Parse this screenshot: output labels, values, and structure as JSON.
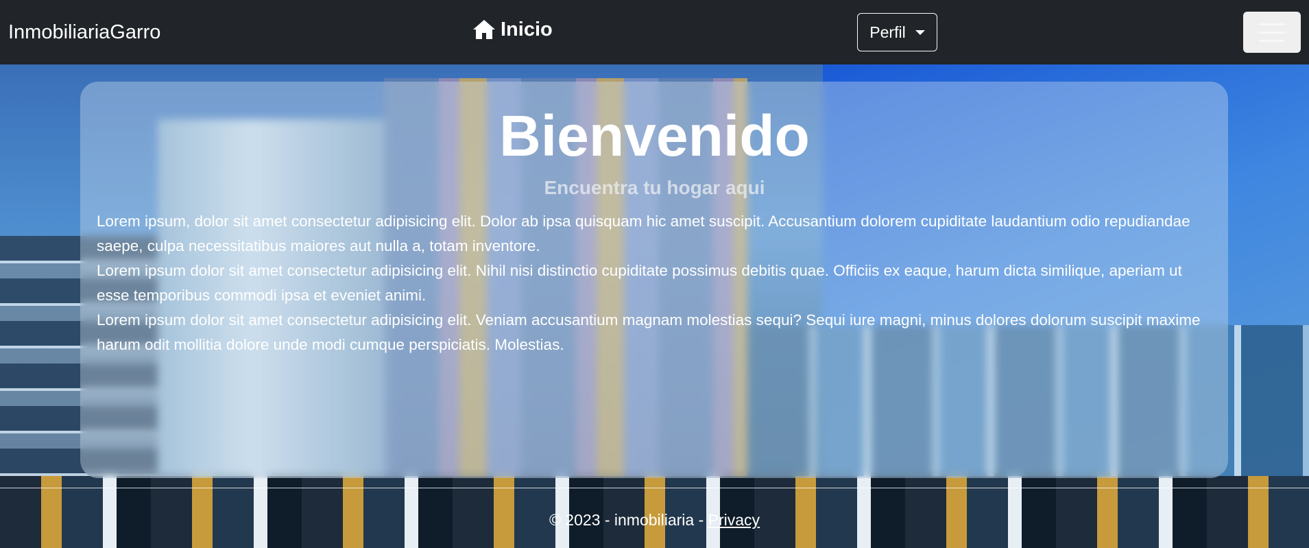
{
  "navbar": {
    "brand": "InmobiliariaGarro",
    "home_label": "Inicio",
    "home_icon": "home-icon",
    "profile_label": "Perfil",
    "toggler_icon": "hamburger-menu-icon",
    "background_color": "#212529"
  },
  "hero": {
    "title": "Bienvenido",
    "subtitle": "Encuentra tu hogar aqui",
    "paragraphs": [
      "Lorem ipsum, dolor sit amet consectetur adipisicing elit. Dolor ab ipsa quisquam hic amet suscipit. Accusantium dolorem cupiditate laudantium odio repudiandae saepe, culpa necessitatibus maiores aut nulla a, totam inventore.",
      "Lorem ipsum dolor sit amet consectetur adipisicing elit. Nihil nisi distinctio cupiditate possimus debitis quae. Officiis ex eaque, harum dicta similique, aperiam ut esse temporibus commodi ipsa et eveniet animi.",
      "Lorem ipsum dolor sit amet consectetur adipisicing elit. Veniam accusantium magnam molestias sequi? Sequi iure magni, minus dolores dolorum suscipit maxime harum odit mollitia dolore unde modi cumque perspiciatis. Molestias."
    ]
  },
  "footer": {
    "copyright": "© 2023 - inmobiliaria - ",
    "privacy_link": "Privacy"
  }
}
